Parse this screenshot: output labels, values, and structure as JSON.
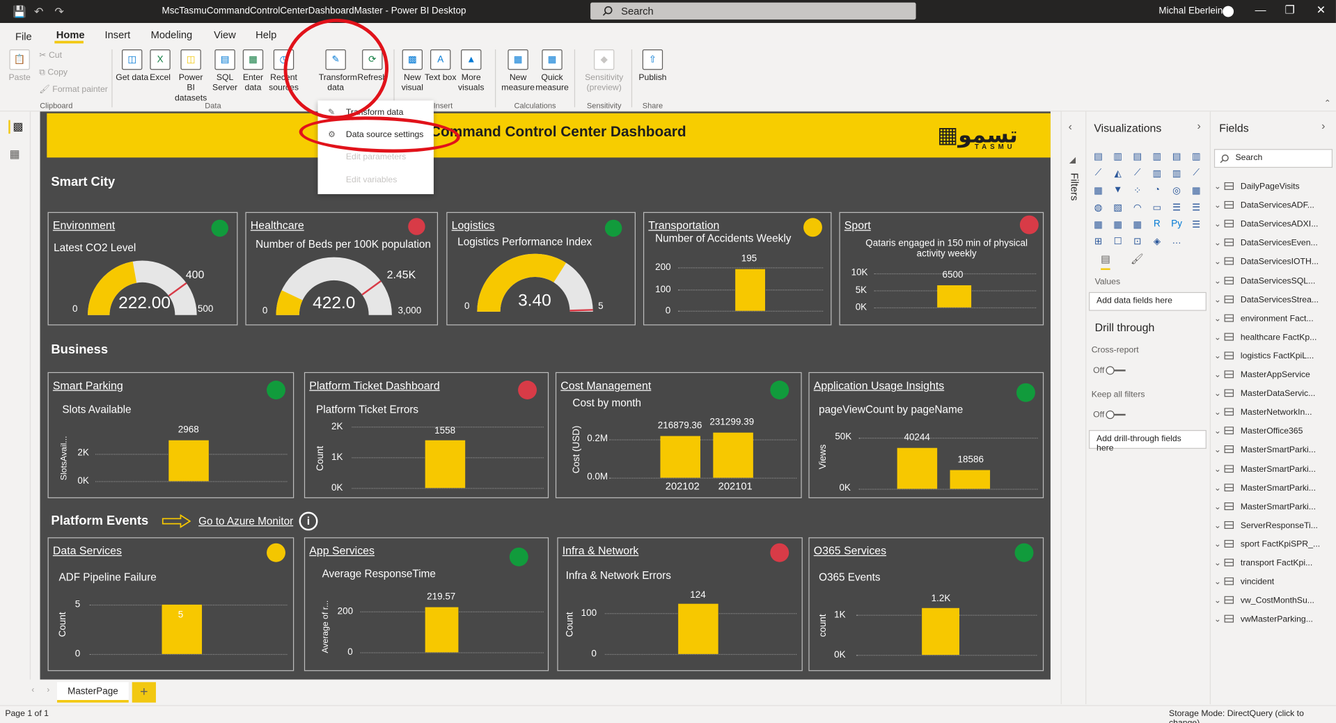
{
  "titlebar": {
    "title": "MscTasmuCommandControlCenterDashboardMaster - Power BI Desktop",
    "search": "Search",
    "user": "Michal Eberlein"
  },
  "menu": {
    "file": "File",
    "home": "Home",
    "insert": "Insert",
    "modeling": "Modeling",
    "view": "View",
    "help": "Help"
  },
  "ribbon": {
    "paste": "Paste",
    "cut": "Cut",
    "copy": "Copy",
    "format_painter": "Format painter",
    "get_data": "Get data",
    "excel": "Excel",
    "pbi_datasets": "Power BI datasets",
    "sql_server": "SQL Server",
    "enter_data": "Enter data",
    "recent_sources": "Recent sources",
    "transform_data": "Transform data",
    "refresh": "Refresh",
    "new_visual": "New visual",
    "text_box": "Text box",
    "more_visuals": "More visuals",
    "new_measure": "New measure",
    "quick_measure": "Quick measure",
    "sensitivity": "Sensitivity (preview)",
    "publish": "Publish",
    "groups": {
      "clipboard": "Clipboard",
      "data": "Data",
      "insert": "Insert",
      "calculations": "Calculations",
      "sensitivity": "Sensitivity",
      "share": "Share"
    }
  },
  "dropdown": {
    "transform_data": "Transform data",
    "data_source_settings": "Data source settings",
    "edit_parameters": "Edit parameters",
    "edit_variables": "Edit variables"
  },
  "report": {
    "banner_title": "Command  Control Center Dashboard",
    "logo_text": "TASMU",
    "sections": {
      "smart_city": "Smart City",
      "business": "Business",
      "platform_events": "Platform Events",
      "azure_link": "Go to Azure Monitor"
    },
    "smart_city": [
      {
        "link": "Environment",
        "status": "green",
        "subtitle": "Latest CO2 Level",
        "value": "222.00",
        "min": "0",
        "max": "500",
        "target": "400",
        "fill": 0.444
      },
      {
        "link": "Healthcare",
        "status": "red",
        "subtitle": "Number of Beds per 100K population",
        "value": "422.0",
        "min": "0",
        "max": "3,000",
        "target": "2.45K",
        "fill": 0.141
      },
      {
        "link": "Logistics",
        "status": "green",
        "subtitle": "Logistics Performance Index",
        "value": "3.40",
        "min": "0",
        "max": "5",
        "fill": 0.68
      },
      {
        "link": "Transportation",
        "status": "yellow",
        "subtitle": "Number of Accidents Weekly",
        "value": "195",
        "ticks": [
          "200",
          "100",
          "0"
        ]
      },
      {
        "link": "Sport",
        "status": "red",
        "subtitle": "Qataris engaged in 150 min of physical activity weekly",
        "value": "6500",
        "ticks": [
          "10K",
          "5K",
          "0K"
        ]
      }
    ],
    "business": [
      {
        "link": "Smart Parking ",
        "status": "green",
        "subtitle": "Slots Available",
        "ylabel": "SlotsAvail...",
        "value": "2968",
        "ticks": [
          "2K",
          "0K"
        ]
      },
      {
        "link": "Platform Ticket Dashboard",
        "status": "red",
        "subtitle": "Platform Ticket Errors",
        "ylabel": "Count",
        "value": "1558",
        "ticks": [
          "2K",
          "1K",
          "0K"
        ]
      },
      {
        "link": "Cost Management",
        "status": "green",
        "subtitle": "Cost by month",
        "ylabel": "Cost (USD)",
        "ticks": [
          "0.2M",
          "0.0M"
        ],
        "bars": [
          {
            "label": "202102",
            "value": "216879.36"
          },
          {
            "label": "202101",
            "value": "231299.39"
          }
        ]
      },
      {
        "link": "Application Usage Insights",
        "status": "green",
        "subtitle": "pageViewCount by pageName",
        "ylabel": "Views",
        "ticks": [
          "50K",
          "0K"
        ],
        "bars": [
          {
            "value": "40244"
          },
          {
            "value": "18586"
          }
        ]
      }
    ],
    "platform": [
      {
        "link": "Data Services",
        "status": "yellow",
        "subtitle": "ADF Pipeline Failure",
        "ylabel": "Count",
        "value": "5",
        "ticks": [
          "5",
          "0"
        ]
      },
      {
        "link": "App Services",
        "status": "green",
        "subtitle": "Average ResponseTime",
        "ylabel": "Average of r...",
        "value": "219.57",
        "ticks": [
          "200",
          "0"
        ]
      },
      {
        "link": "Infra & Network",
        "status": "red",
        "subtitle": "Infra & Network Errors",
        "ylabel": "Count",
        "value": "124",
        "ticks": [
          "100",
          "0"
        ]
      },
      {
        "link": "O365 Services",
        "status": "green",
        "subtitle": "O365 Events",
        "ylabel": "count",
        "value": "1.2K",
        "ticks": [
          "1K",
          "0K"
        ]
      }
    ]
  },
  "filters_label": "Filters",
  "visualizations": {
    "title": "Visualizations",
    "values": "Values",
    "add_fields": "Add data fields here",
    "drill_through": "Drill through",
    "cross_report": "Cross-report",
    "off1": "Off",
    "keep_filters": "Keep all filters",
    "off2": "Off",
    "add_drill": "Add drill-through fields here"
  },
  "fields": {
    "title": "Fields",
    "search": "Search",
    "items": [
      "DailyPageVisits",
      "DataServicesADF...",
      "DataServicesADXI...",
      "DataServicesEven...",
      "DataServicesIOTH...",
      "DataServicesSQL...",
      "DataServicesStrea...",
      "environment Fact...",
      "healthcare FactKp...",
      "logistics FactKpiL...",
      "MasterAppService",
      "MasterDataServic...",
      "MasterNetworkIn...",
      "MasterOffice365",
      "MasterSmartParki...",
      "MasterSmartParki...",
      "MasterSmartParki...",
      "MasterSmartParki...",
      "ServerResponseTi...",
      "sport FactKpiSPR_...",
      "transport FactKpi...",
      "vincident",
      "vw_CostMonthSu...",
      "vwMasterParking..."
    ]
  },
  "tabs": {
    "page": "MasterPage",
    "add": "+"
  },
  "status": {
    "page": "Page 1 of 1",
    "storage": "Storage Mode: DirectQuery (click to change)"
  },
  "colors": {
    "green": "#119b3c",
    "red": "#d83b47",
    "yellow": "#f4c600",
    "banner": "#f7cd00",
    "canvas": "#4a4a4a"
  }
}
